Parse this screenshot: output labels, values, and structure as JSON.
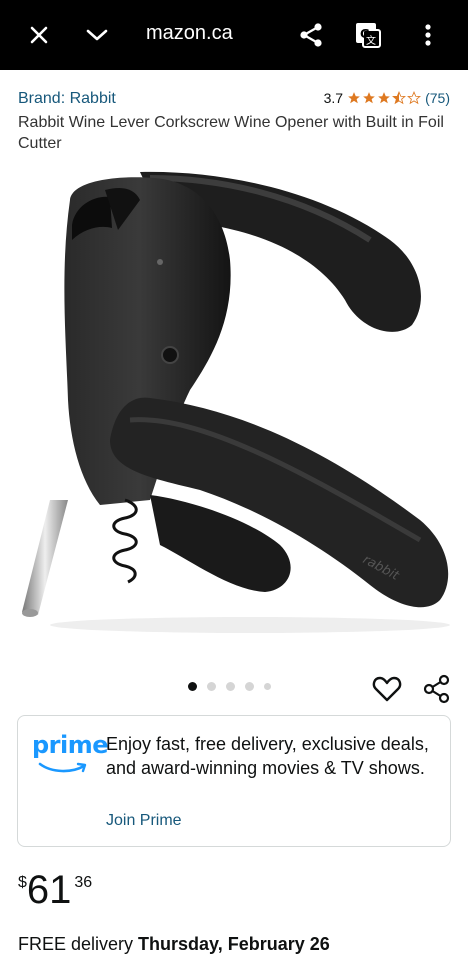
{
  "browser": {
    "url": "mazon.ca",
    "icons": [
      "close-icon",
      "chevron-down-icon",
      "share-icon",
      "translate-icon",
      "more-vert-icon"
    ]
  },
  "product": {
    "brand": "Brand: Rabbit",
    "rating_value": "3.7",
    "rating_stars": 3.5,
    "rating_count": "(75)",
    "title": "Rabbit Wine Lever Corkscrew Wine Opener with Built in Foil Cutter",
    "image_logo_text": "rabbit"
  },
  "carousel": {
    "total": 5,
    "active": 1
  },
  "prime": {
    "logo": "prime",
    "message": "Enjoy fast, free delivery, exclusive deals, and award-winning movies & TV shows.",
    "cta": "Join Prime"
  },
  "price": {
    "currency": "$",
    "whole": "61",
    "fraction": "36"
  },
  "delivery": {
    "prefix": "FREE delivery",
    "date": "Thursday, February 26"
  },
  "colors": {
    "link": "#17587b",
    "star": "#de7921",
    "prime": "#1a98ff",
    "topbar": "#000000"
  }
}
